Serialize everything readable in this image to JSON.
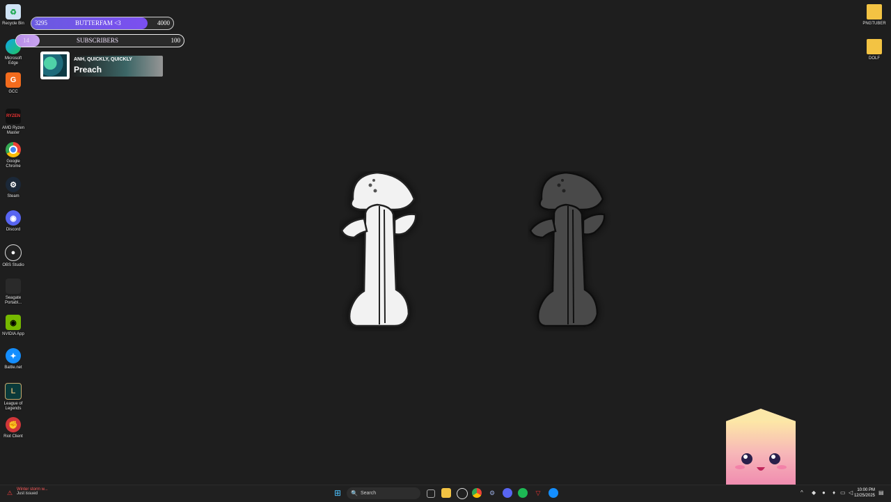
{
  "desktop_icons_left": [
    {
      "label": "Recycle Bin",
      "icon": "recycle-bin-icon"
    },
    {
      "label": "Microsoft Edge",
      "icon": "edge-icon"
    },
    {
      "label": "GCC",
      "icon": "gcc-icon"
    },
    {
      "label": "AMD Ryzen Master",
      "icon": "amd-ryzen-icon"
    },
    {
      "label": "Google Chrome",
      "icon": "chrome-icon"
    },
    {
      "label": "Steam",
      "icon": "steam-icon"
    },
    {
      "label": "Discord",
      "icon": "discord-icon"
    },
    {
      "label": "OBS Studio",
      "icon": "obs-icon"
    },
    {
      "label": "Seagate Portabl...",
      "icon": "seagate-icon"
    },
    {
      "label": "NVIDIA App",
      "icon": "nvidia-icon"
    },
    {
      "label": "Battle.net",
      "icon": "battlenet-icon"
    },
    {
      "label": "League of Legends",
      "icon": "league-icon"
    },
    {
      "label": "Riot Client",
      "icon": "riot-icon"
    }
  ],
  "desktop_icons_right": [
    {
      "label": "PNGTUBER",
      "icon": "folder-icon"
    },
    {
      "label": "DOLF",
      "icon": "folder-icon"
    }
  ],
  "goal_bar_1": {
    "current": "3295",
    "label": "BUTTERFAM <3",
    "target": "4000",
    "progress": 0.82,
    "color": "#6a5ae0"
  },
  "goal_bar_2": {
    "current": "14",
    "label": "SUBSCRIBERS",
    "target": "100",
    "progress": 0.14,
    "color": "#b78ee8"
  },
  "now_playing": {
    "artist": "ANH, QUICKLY, QUICKLY",
    "title": "Preach"
  },
  "taskbar": {
    "search_placeholder": "Search",
    "weather_line1": "Winter storm w...",
    "weather_line2": "Just issued",
    "time": "10:00 PM",
    "date": "12/25/2025",
    "pinned": [
      {
        "icon": "windows-start-icon"
      },
      {
        "icon": "task-view-icon"
      },
      {
        "icon": "file-explorer-icon"
      },
      {
        "icon": "obs-icon"
      },
      {
        "icon": "chrome-icon"
      },
      {
        "icon": "steam-icon"
      },
      {
        "icon": "discord-icon"
      },
      {
        "icon": "spotify-icon"
      },
      {
        "icon": "riot-icon"
      },
      {
        "icon": "battlenet-icon"
      }
    ]
  }
}
